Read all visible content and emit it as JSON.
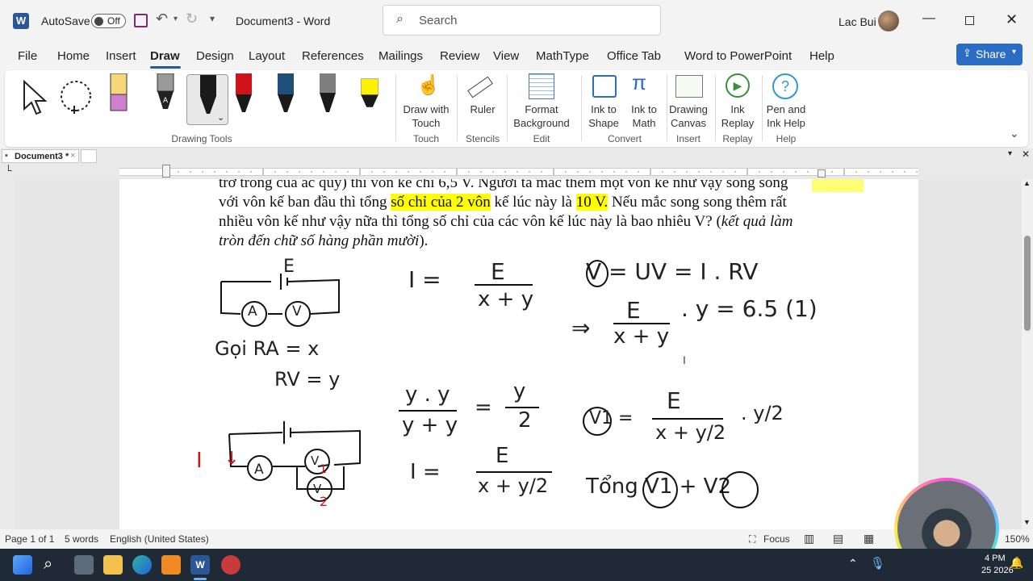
{
  "titlebar": {
    "autosave_label": "AutoSave",
    "autosave_state": "Off",
    "doc_title": "Document3  -  Word",
    "search_placeholder": "Search",
    "user_name": "Lac Bui"
  },
  "menu": {
    "items": [
      "File",
      "Home",
      "Insert",
      "Draw",
      "Design",
      "Layout",
      "References",
      "Mailings",
      "Review",
      "View",
      "MathType",
      "Office Tab",
      "Word to PowerPoint",
      "Help"
    ],
    "active": "Draw",
    "share_label": "Share"
  },
  "ribbon": {
    "drawing_tools_label": "Drawing Tools",
    "draw_with_touch": "Draw with Touch",
    "touch_group": "Touch",
    "ruler": "Ruler",
    "stencils_group": "Stencils",
    "format_background": "Format Background",
    "edit_group": "Edit",
    "ink_to_shape": "Ink to Shape",
    "ink_to_math": "Ink to Math",
    "convert_group": "Convert",
    "drawing_canvas": "Drawing Canvas",
    "insert_group": "Insert",
    "ink_replay": "Ink Replay",
    "replay_group": "Replay",
    "pen_ink_help": "Pen and Ink Help",
    "help_group": "Help",
    "pen_colors": [
      "#f6d77a",
      "#9a9a9a",
      "#1a1a1a",
      "#d0121b",
      "#1f4e79",
      "#7f7f7f",
      "#fff200"
    ]
  },
  "doctab": {
    "name": "Document3 *"
  },
  "document": {
    "line1": "trở trong của ắc quy) thì vôn kế chỉ 6,5 V. Người ta mắc thêm một vôn kế như vậy song song",
    "line2_a": "với vôn kế ban đầu thì tổng ",
    "line2_hl1": "số chỉ của 2 vôn",
    "line2_b": " kế lúc này là ",
    "line2_hl2": "10 V.",
    "line2_c": " Nếu mắc song song thêm rất",
    "line3_a": "nhiều vôn kế như vậy nữa thì tổng số chỉ của các vôn kế lúc này là bao nhiêu V? (",
    "line3_i": "kết quả làm",
    "line4_i": "tròn đến chữ số hàng phần mười",
    "line4_b": ")."
  },
  "ink": {
    "battery_E": "E",
    "ammeter": "A",
    "voltmeter": "V",
    "goi_ra": "Gọi  RA = x",
    "rv": "RV = y",
    "eq1_left": "I  =",
    "eq1_num": "E",
    "eq1_den": "x + y",
    "eq2": "V = UV = I . RV",
    "eq3_arrow": "⇒",
    "eq3_num": "E",
    "eq3_den": "x + y",
    "eq3_rest": ". y  =  6.5  (1)",
    "eq4_num": "y . y",
    "eq4_den": "y + y",
    "eq4_eq": "=",
    "eq4_rnum": "y",
    "eq4_rden": "2",
    "eq5_left": "V1  =",
    "eq5_num": "E",
    "eq5_den": "x + y/2",
    "eq5_rest": ". y/2",
    "eq6_left": "I  =",
    "eq6_num": "E",
    "eq6_den": "x + y/2",
    "tong": "Tổng  V1  +  V2",
    "red_I": "I",
    "red_1": "1",
    "red_2": "2"
  },
  "status": {
    "page": "Page 1 of 1",
    "words": "5 words",
    "language": "English (United States)",
    "focus": "Focus",
    "zoom": "150%"
  },
  "taskbar": {
    "time": "4 PM",
    "date": "25 2026"
  }
}
